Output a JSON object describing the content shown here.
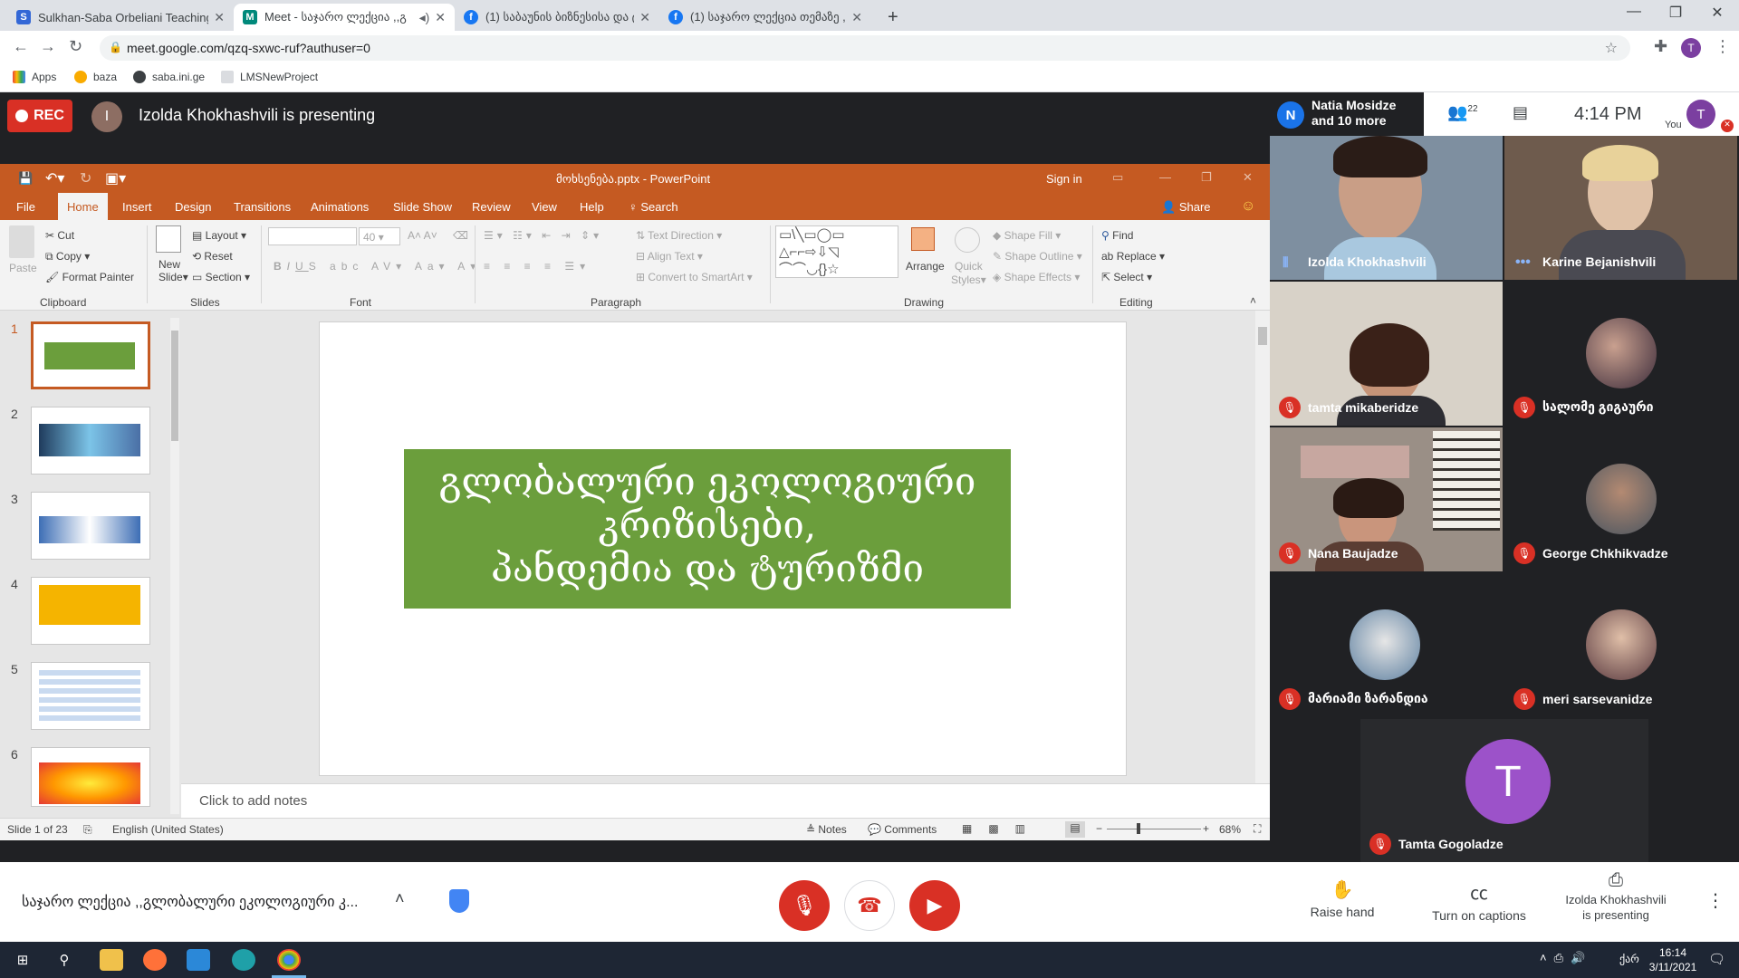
{
  "browser": {
    "tabs": [
      {
        "title": "Sulkhan-Saba Orbeliani Teaching",
        "icon_color": "#3367d6",
        "icon_letter": "S"
      },
      {
        "title": "Meet - საჯარო ლექცია ,,გ",
        "icon_color": "#00897b",
        "icon_letter": "M",
        "active": true
      },
      {
        "title": "(1) საბაუნის ბიზნესისა და ტ",
        "icon_color": "#1877f2",
        "icon_letter": "f"
      },
      {
        "title": "(1) საჯარო ლექცია თემაზე ,,",
        "icon_color": "#1877f2",
        "icon_letter": "f"
      }
    ],
    "new_tab": "+",
    "url": "meet.google.com/qzq-sxwc-ruf?authuser=0",
    "profile_letter": "T",
    "bookmarks": [
      "Apps",
      "baza",
      "saba.ini.ge",
      "LMSNewProject"
    ]
  },
  "meet": {
    "rec_label": "REC",
    "presenter_initial": "I",
    "presenting_text": "Izolda Khokhashvili is presenting",
    "top_avatar": "N",
    "top_names": [
      "Natia Mosidze",
      "and 10 more"
    ],
    "participant_count": "22",
    "time": "4:14 PM",
    "you_label": "You",
    "you_initial": "T",
    "meeting_name": "საჯარო ლექცია ,,გლობალური ეკოლოგიური კ...",
    "raise_hand": "Raise hand",
    "captions": "Turn on captions",
    "presenting_line1": "Izolda Khokhashvili",
    "presenting_line2": "is presenting",
    "participants": [
      {
        "name": "Izolda Khokhashvili",
        "muted": false
      },
      {
        "name": "Karine Bejanishvili",
        "muted": false
      },
      {
        "name": "tamta mikaberidze",
        "muted": true
      },
      {
        "name": "სალომე გიგაური",
        "muted": true
      },
      {
        "name": "Nana Baujadze",
        "muted": true
      },
      {
        "name": "George Chkhikvadze",
        "muted": true
      },
      {
        "name": "მარიამი ზარანდია",
        "muted": true
      },
      {
        "name": "meri sarsevanidze",
        "muted": true
      },
      {
        "name": "Tamta Gogoladze",
        "muted": true,
        "initial": "T"
      }
    ]
  },
  "ppt": {
    "title": "მოხსენება.pptx - PowerPoint",
    "sign_in": "Sign in",
    "tabs": [
      "File",
      "Home",
      "Insert",
      "Design",
      "Transitions",
      "Animations",
      "Slide Show",
      "Review",
      "View",
      "Help"
    ],
    "search": "Search",
    "share": "Share",
    "ribbon": {
      "paste": "Paste",
      "cut": "Cut",
      "copy": "Copy",
      "format_painter": "Format Painter",
      "clipboard": "Clipboard",
      "new_slide": "New",
      "new_slide2": "Slide",
      "layout": "Layout",
      "reset": "Reset",
      "section": "Section",
      "slides": "Slides",
      "font_size": "40",
      "font": "Font",
      "text_direction": "Text Direction",
      "align_text": "Align Text",
      "smartart": "Convert to SmartArt",
      "paragraph": "Paragraph",
      "arrange": "Arrange",
      "quick_styles1": "Quick",
      "quick_styles2": "Styles",
      "shape_fill": "Shape Fill",
      "shape_outline": "Shape Outline",
      "shape_effects": "Shape Effects",
      "drawing": "Drawing",
      "find": "Find",
      "replace": "Replace",
      "select": "Select",
      "editing": "Editing"
    },
    "slide_title": [
      "გლობალური ეკოლოგიური",
      "კრიზისები,",
      "პანდემია და  ტურიზმი"
    ],
    "thumb_numbers": [
      "1",
      "2",
      "3",
      "4",
      "5",
      "6"
    ],
    "notes_placeholder": "Click to add notes",
    "status_slide": "Slide 1 of 23",
    "status_lang": "English (United States)",
    "status_notes": "Notes",
    "status_comments": "Comments",
    "zoom": "68%"
  },
  "taskbar": {
    "time": "16:14",
    "date": "3/11/2021",
    "lang": "ქარ"
  }
}
